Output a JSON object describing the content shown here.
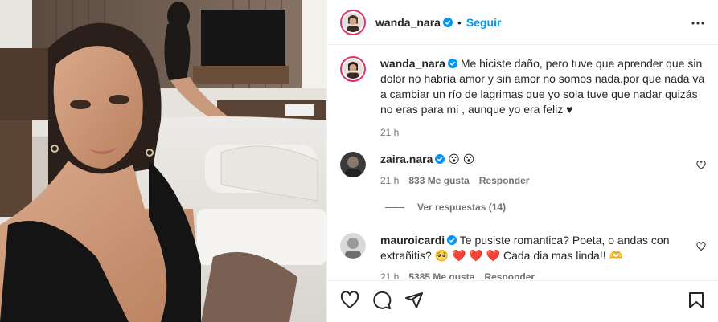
{
  "post": {
    "author": "wanda_nara",
    "follow_label": "Seguir",
    "separator": "•"
  },
  "caption": {
    "author": "wanda_nara",
    "text": "Me hiciste daño, pero tuve que aprender que sin dolor no habría amor y sin amor no somos nada.por que nada va a cambiar un río de lagrimas que yo sola tuve que nadar quizás no eras para mi , aunque yo era feliz ♥",
    "time": "21 h"
  },
  "comments": [
    {
      "author": "zaira.nara",
      "text": "😮 😮",
      "time": "21 h",
      "likes": "833 Me gusta",
      "reply_label": "Responder"
    },
    {
      "author": "mauroicardi",
      "text": "Te pusiste romantica? Poeta, o andas con extrañitis? 🥺 ❤️ ❤️ ❤️  Cada dia mas linda!! 🫶",
      "time": "21 h",
      "likes": "5385 Me gusta",
      "reply_label": "Responder"
    }
  ],
  "replies_label": "Ver respuestas (14)",
  "icons": {
    "verified": "verified-badge-icon",
    "more": "more-options-icon",
    "like": "heart-icon",
    "comment": "comment-icon",
    "share": "share-icon",
    "save": "bookmark-icon"
  },
  "colors": {
    "accent": "#0095f6",
    "text": "#262626",
    "muted": "#737373",
    "border": "#efefef"
  }
}
